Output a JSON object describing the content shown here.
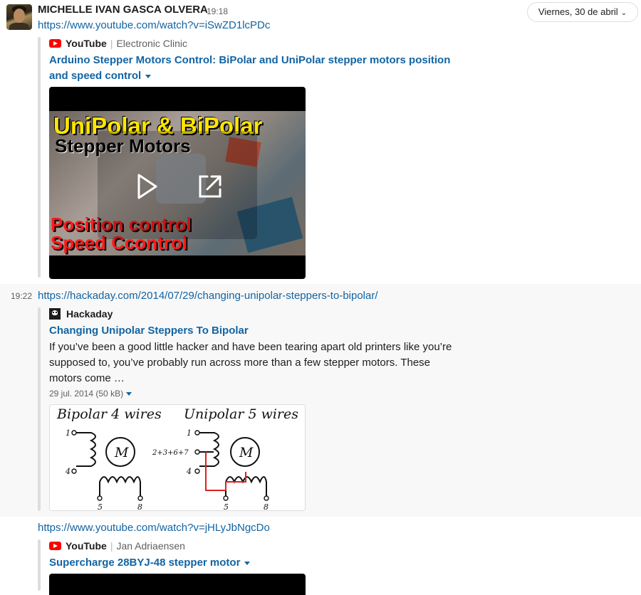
{
  "header": {
    "sender": "MICHELLE IVAN GASCA OLVERA",
    "time": "19:18",
    "date_label": "Viernes, 30 de abril"
  },
  "msg1": {
    "url": "https://www.youtube.com/watch?v=iSwZD1lcPDc",
    "service": "YouTube",
    "author": "Electronic Clinic",
    "title": "Arduino Stepper Motors Control: BiPolar and UniPolar stepper motors position and speed control",
    "thumbnail": {
      "line1": "UniPolar & BiPolar",
      "line2": "Stepper Motors",
      "line3": "Position control",
      "line4": "Speed Ccontrol"
    }
  },
  "msg2": {
    "time": "19:22",
    "url": "https://hackaday.com/2014/07/29/changing-unipolar-steppers-to-bipolar/",
    "service": "Hackaday",
    "title": "Changing Unipolar Steppers To Bipolar",
    "description": "If you’ve been a good little hacker and have been tearing apart old printers like you’re supposed to, you’ve probably run across more than a few stepper motors. These motors come …",
    "meta": "29 jul. 2014 (50 kB)",
    "diagram": {
      "left_title": "Bipolar 4 wires",
      "right_title": "Unipolar 5 wires",
      "motor_label": "M",
      "pin1": "1",
      "pin4": "4",
      "pin5": "5",
      "pin8": "8",
      "pin_common": "2+3+6+7"
    }
  },
  "msg3": {
    "url": "https://www.youtube.com/watch?v=jHLyJbNgcDo",
    "service": "YouTube",
    "author": "Jan Adriaensen",
    "title": "Supercharge 28BYJ-48 stepper motor"
  },
  "colors": {
    "link": "#1264a3",
    "youtube_red": "#ff0000",
    "wire_red": "#e0201c"
  }
}
